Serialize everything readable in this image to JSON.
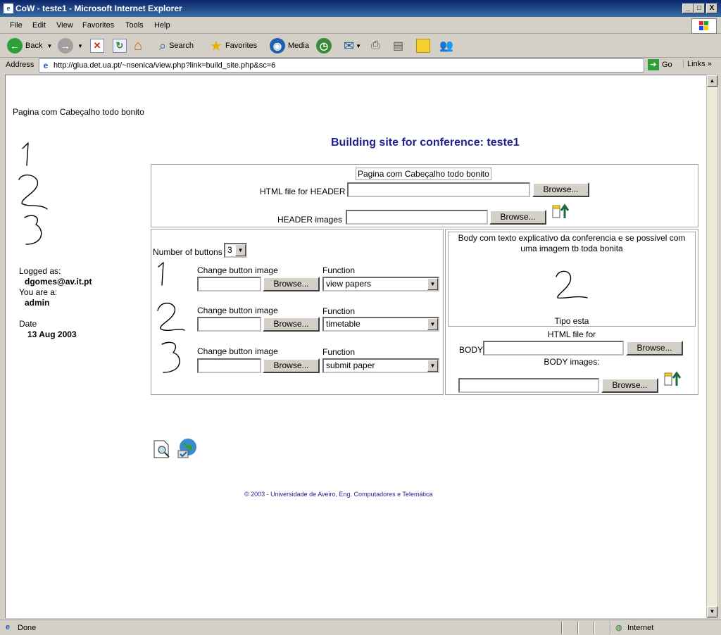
{
  "window": {
    "title": "CoW - teste1 - Microsoft Internet Explorer",
    "controls": [
      "_",
      "□",
      "X"
    ]
  },
  "menu": [
    "File",
    "Edit",
    "View",
    "Favorites",
    "Tools",
    "Help"
  ],
  "toolbar": {
    "back": "Back",
    "search": "Search",
    "favorites": "Favorites",
    "media": "Media"
  },
  "address": {
    "label": "Address",
    "url": "http://glua.det.ua.pt/~nsenica/view.php?link=build_site.php&sc=6",
    "go": "Go",
    "links": "Links"
  },
  "page": {
    "header_placeholder": "Pagina com Cabeçalho todo bonito",
    "title": "Building site for conference: teste1",
    "sidebar": {
      "logged_as_label": "Logged as:",
      "user": "dgomes@av.it.pt",
      "role_label": "You are a:",
      "role": "admin",
      "date_label": "Date",
      "date": "13 Aug 2003"
    },
    "header_section": {
      "preview": "Pagina com Cabeçalho todo bonito",
      "html_label": "HTML file for HEADER",
      "images_label": "HEADER images",
      "browse": "Browse..."
    },
    "buttons_section": {
      "num_label": "Number of buttons",
      "num_value": "3",
      "rows": [
        {
          "change_label": "Change button image",
          "function_label": "Function",
          "browse": "Browse...",
          "function": "view papers"
        },
        {
          "change_label": "Change button image",
          "function_label": "Function",
          "browse": "Browse...",
          "function": "timetable"
        },
        {
          "change_label": "Change button image",
          "function_label": "Function",
          "browse": "Browse...",
          "function": "submit paper"
        }
      ]
    },
    "body_section": {
      "preview_text": "Body com texto explicativo da conferencia e se possivel com uma imagem tb toda bonita",
      "preview_caption": "Tipo esta",
      "html_label": "HTML file for",
      "body_label": "BODY",
      "images_label": "BODY images:",
      "browse": "Browse..."
    },
    "footer": "© 2003 - Universidade de Aveiro, Eng. Computadores e Telemática"
  },
  "status": {
    "text": "Done",
    "zone": "Internet"
  },
  "colors": {
    "title_blue": "#1f1f8f",
    "titlebar": "#0a246a"
  }
}
